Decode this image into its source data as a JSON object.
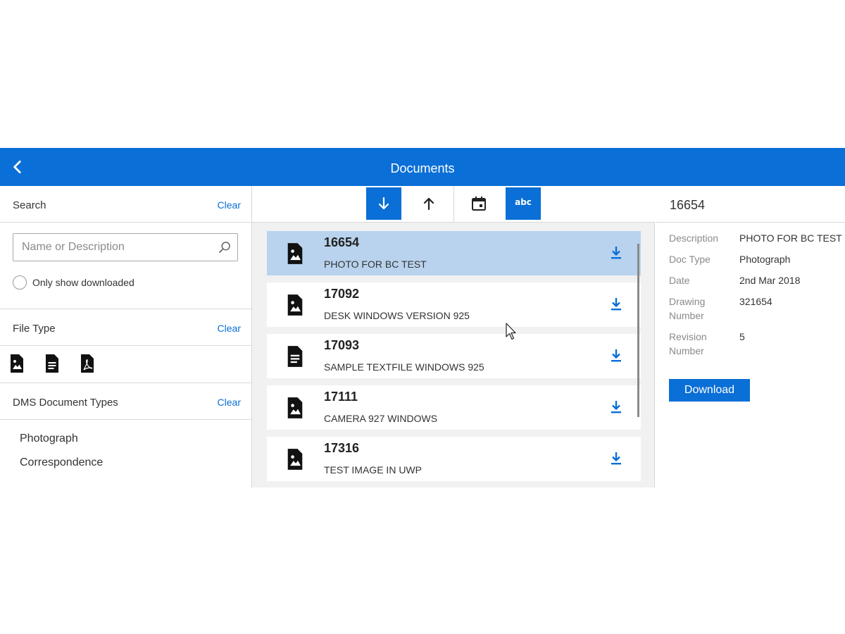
{
  "header": {
    "title": "Documents",
    "back_icon": "chevron-left-icon"
  },
  "search": {
    "label": "Search",
    "clear_label": "Clear",
    "placeholder": "Name or Description",
    "value": "",
    "only_downloaded_label": "Only show downloaded",
    "only_downloaded_checked": false
  },
  "file_type": {
    "label": "File Type",
    "clear_label": "Clear",
    "icons": [
      "image-file-icon",
      "text-file-icon",
      "pdf-file-icon"
    ]
  },
  "dms": {
    "label": "DMS Document Types",
    "clear_label": "Clear",
    "items": [
      "Photograph",
      "Correspondence"
    ]
  },
  "toolbar": {
    "sort_descending_active": true,
    "sort_ascending_active": false,
    "sort_date_active": false,
    "sort_alpha_active": true,
    "alpha_label": "abc"
  },
  "documents": [
    {
      "number": "16654",
      "description": "PHOTO FOR BC TEST",
      "icon": "image-file-icon",
      "selected": true
    },
    {
      "number": "17092",
      "description": "DESK WINDOWS VERSION 925",
      "icon": "image-file-icon",
      "selected": false
    },
    {
      "number": "17093",
      "description": "SAMPLE TEXTFILE WINDOWS 925",
      "icon": "text-file-icon",
      "selected": false
    },
    {
      "number": "17111",
      "description": "CAMERA 927 WINDOWS",
      "icon": "image-file-icon",
      "selected": false
    },
    {
      "number": "17316",
      "description": "TEST IMAGE IN UWP",
      "icon": "image-file-icon",
      "selected": false
    }
  ],
  "details": {
    "title": "16654",
    "fields": [
      {
        "label": "Description",
        "value": "PHOTO FOR BC TEST"
      },
      {
        "label": "Doc Type",
        "value": "Photograph"
      },
      {
        "label": "Date",
        "value": "2nd Mar 2018"
      },
      {
        "label": "Drawing Number",
        "value": "321654"
      },
      {
        "label": "Revision Number",
        "value": "5"
      }
    ],
    "download_label": "Download"
  },
  "colors": {
    "accent": "#0a6fd6",
    "selected_row": "#b9d3ee",
    "list_background": "#f1f1f1"
  }
}
